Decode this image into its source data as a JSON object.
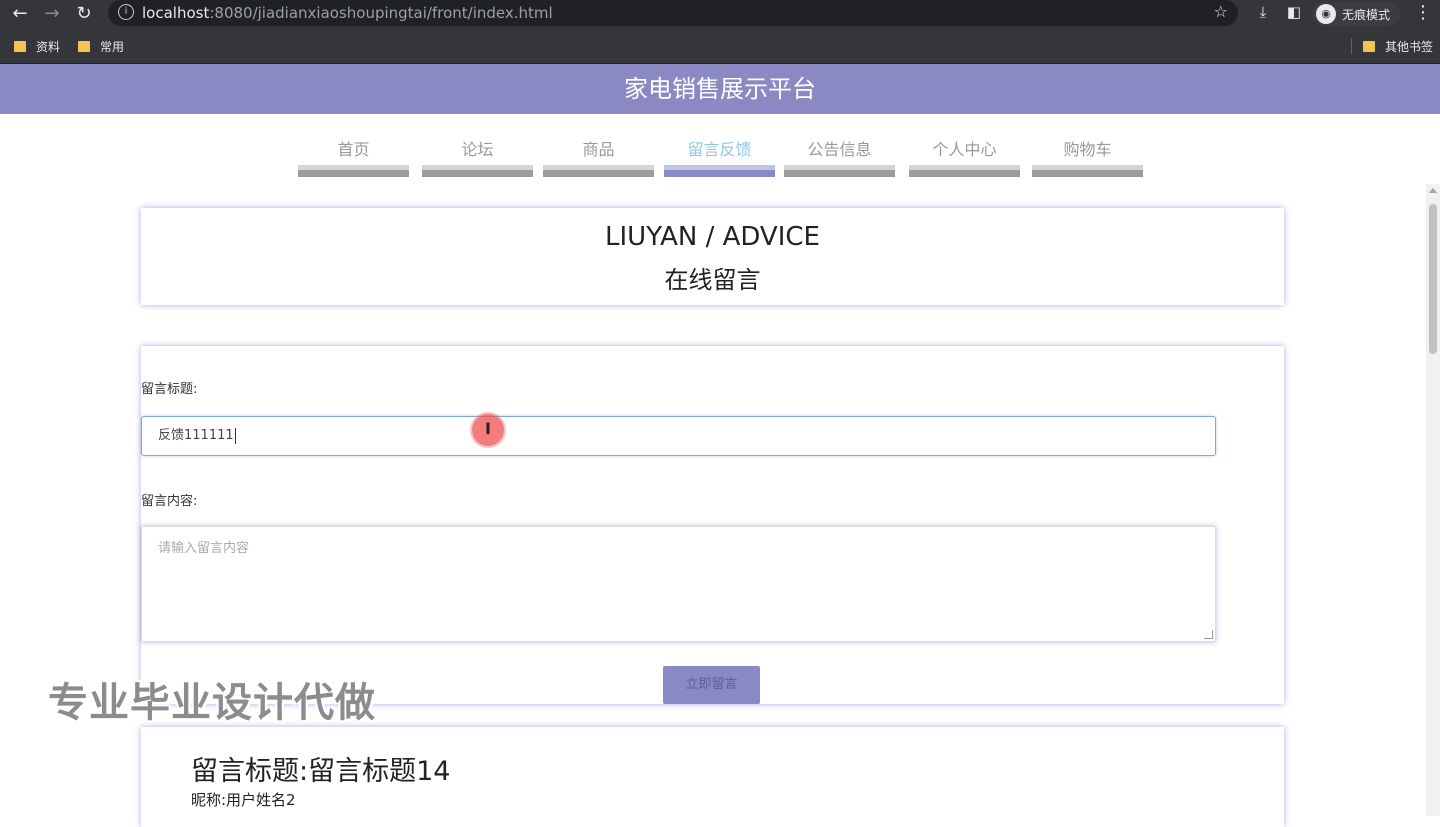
{
  "browser": {
    "url_host": "localhost",
    "url_rest": ":8080/jiadianxiaoshoupingtai/front/index.html",
    "incognito_label": "无痕模式",
    "bookmarks": [
      {
        "label": "资料"
      },
      {
        "label": "常用"
      }
    ],
    "other_bookmarks": "其他书签"
  },
  "site": {
    "title": "家电销售展示平台",
    "nav": [
      {
        "label": "首页",
        "active": false
      },
      {
        "label": "论坛",
        "active": false
      },
      {
        "label": "商品",
        "active": false
      },
      {
        "label": "留言反馈",
        "active": true
      },
      {
        "label": "公告信息",
        "active": false
      },
      {
        "label": "个人中心",
        "active": false
      },
      {
        "label": "购物车",
        "active": false
      }
    ]
  },
  "header_card": {
    "title_en": "LIUYAN / ADVICE",
    "title_cn": "在线留言"
  },
  "form": {
    "title_label": "留言标题:",
    "title_value": "反馈111111",
    "content_label": "留言内容:",
    "content_placeholder": "请输入留言内容",
    "submit_label": "立即留言"
  },
  "messages": [
    {
      "title": "留言标题:留言标题14",
      "nickname": "昵称:用户姓名2"
    }
  ],
  "watermark": "专业毕业设计代做",
  "cursor_glyph": "I",
  "colors": {
    "primary": "#8a89c4",
    "nav_active_text": "#8fc6e5",
    "chrome": "#35363a"
  }
}
